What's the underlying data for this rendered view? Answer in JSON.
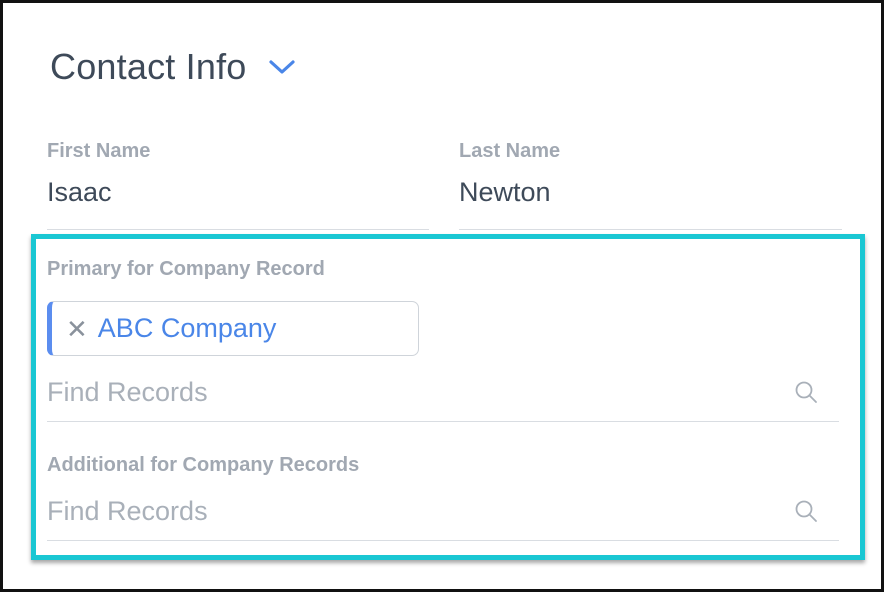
{
  "section": {
    "title": "Contact Info"
  },
  "fields": {
    "first_name": {
      "label": "First Name",
      "value": "Isaac"
    },
    "last_name": {
      "label": "Last Name",
      "value": "Newton"
    }
  },
  "primary_company": {
    "label": "Primary for Company Record",
    "chip": {
      "remove_glyph": "✕",
      "label": "ABC Company"
    },
    "search_placeholder": "Find Records"
  },
  "additional_company": {
    "label": "Additional for Company Records",
    "search_placeholder": "Find Records"
  },
  "colors": {
    "accent": "#4a86e8",
    "highlight": "#1ac7d3",
    "text": "#3e4a59",
    "label": "#a1a8b2"
  },
  "icons": {
    "chevron": "chevron-down-icon",
    "search": "search-icon",
    "remove": "close-icon"
  }
}
